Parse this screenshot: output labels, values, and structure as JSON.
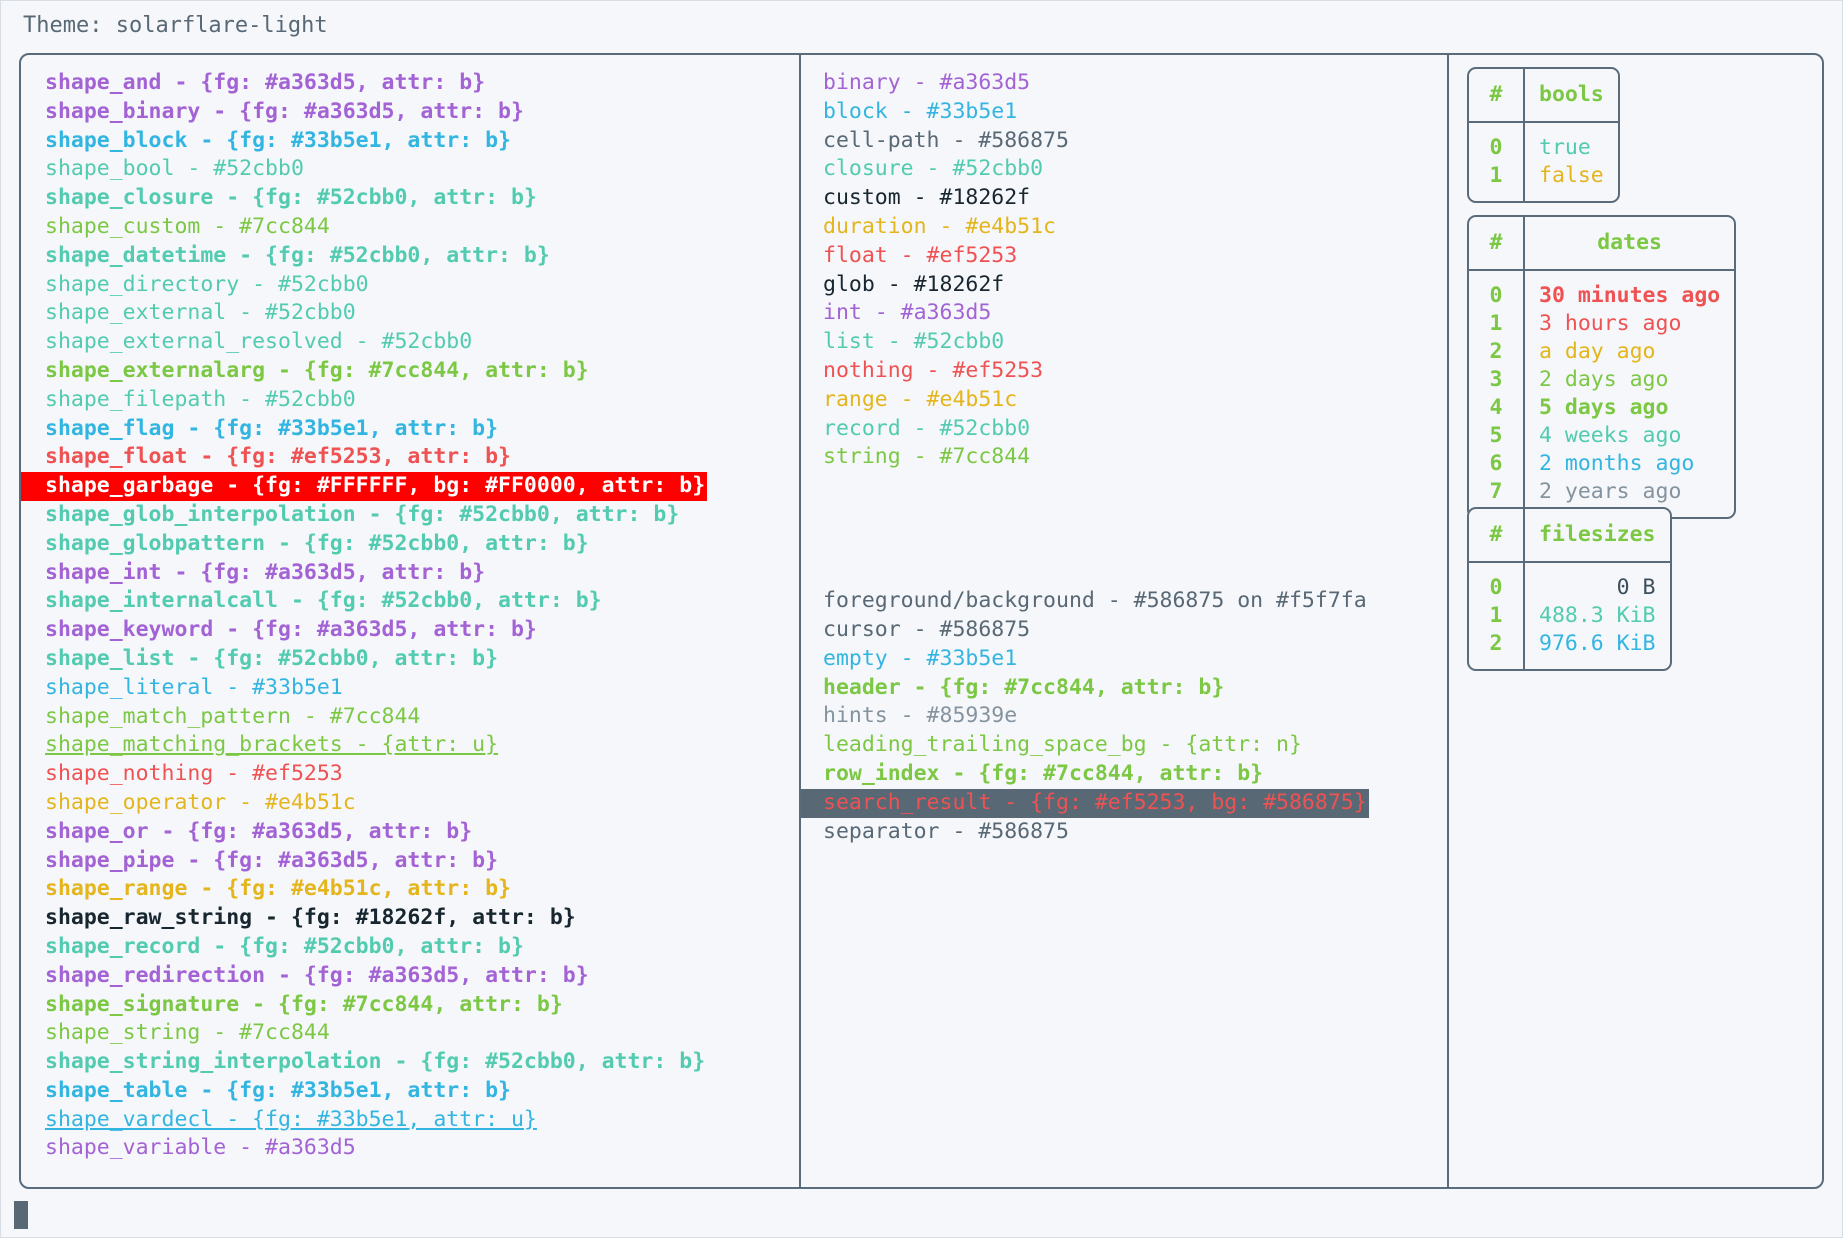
{
  "header": {
    "theme_label": "Theme: solarflare-light"
  },
  "palette": {
    "purple": "#a363d5",
    "blue": "#33b5e1",
    "teal": "#52cbb0",
    "green": "#7cc844",
    "red": "#ef5253",
    "amber": "#e4b51c",
    "dark": "#18262f",
    "gray": "#586875",
    "hint_gray": "#85939e",
    "background": "#f5f7fa",
    "garbage_fg": "#FFFFFF",
    "garbage_bg": "#FF0000",
    "search_bg": "#586875"
  },
  "shapes_column": [
    {
      "text": "shape_and - {fg: #a363d5, attr: b}",
      "color": "#a363d5",
      "bold": true
    },
    {
      "text": "shape_binary - {fg: #a363d5, attr: b}",
      "color": "#a363d5",
      "bold": true
    },
    {
      "text": "shape_block - {fg: #33b5e1, attr: b}",
      "color": "#33b5e1",
      "bold": true
    },
    {
      "text": "shape_bool - #52cbb0",
      "color": "#52cbb0",
      "bold": false
    },
    {
      "text": "shape_closure - {fg: #52cbb0, attr: b}",
      "color": "#52cbb0",
      "bold": true
    },
    {
      "text": "shape_custom - #7cc844",
      "color": "#7cc844",
      "bold": false
    },
    {
      "text": "shape_datetime - {fg: #52cbb0, attr: b}",
      "color": "#52cbb0",
      "bold": true
    },
    {
      "text": "shape_directory - #52cbb0",
      "color": "#52cbb0",
      "bold": false
    },
    {
      "text": "shape_external - #52cbb0",
      "color": "#52cbb0",
      "bold": false
    },
    {
      "text": "shape_external_resolved - #52cbb0",
      "color": "#52cbb0",
      "bold": false
    },
    {
      "text": "shape_externalarg - {fg: #7cc844, attr: b}",
      "color": "#7cc844",
      "bold": true
    },
    {
      "text": "shape_filepath - #52cbb0",
      "color": "#52cbb0",
      "bold": false
    },
    {
      "text": "shape_flag - {fg: #33b5e1, attr: b}",
      "color": "#33b5e1",
      "bold": true
    },
    {
      "text": "shape_float - {fg: #ef5253, attr: b}",
      "color": "#ef5253",
      "bold": true
    },
    {
      "text": "shape_garbage - {fg: #FFFFFF, bg: #FF0000, attr: b}",
      "color": "#FFFFFF",
      "bg": "#FF0000",
      "bold": true
    },
    {
      "text": "shape_glob_interpolation - {fg: #52cbb0, attr: b}",
      "color": "#52cbb0",
      "bold": true
    },
    {
      "text": "shape_globpattern - {fg: #52cbb0, attr: b}",
      "color": "#52cbb0",
      "bold": true
    },
    {
      "text": "shape_int - {fg: #a363d5, attr: b}",
      "color": "#a363d5",
      "bold": true
    },
    {
      "text": "shape_internalcall - {fg: #52cbb0, attr: b}",
      "color": "#52cbb0",
      "bold": true
    },
    {
      "text": "shape_keyword - {fg: #a363d5, attr: b}",
      "color": "#a363d5",
      "bold": true
    },
    {
      "text": "shape_list - {fg: #52cbb0, attr: b}",
      "color": "#52cbb0",
      "bold": true
    },
    {
      "text": "shape_literal - #33b5e1",
      "color": "#33b5e1",
      "bold": false
    },
    {
      "text": "shape_match_pattern - #7cc844",
      "color": "#7cc844",
      "bold": false
    },
    {
      "text": "shape_matching_brackets - {attr: u}",
      "color": "#7cc844",
      "bold": false,
      "underline": true
    },
    {
      "text": "shape_nothing - #ef5253",
      "color": "#ef5253",
      "bold": false
    },
    {
      "text": "shape_operator - #e4b51c",
      "color": "#e4b51c",
      "bold": false
    },
    {
      "text": "shape_or - {fg: #a363d5, attr: b}",
      "color": "#a363d5",
      "bold": true
    },
    {
      "text": "shape_pipe - {fg: #a363d5, attr: b}",
      "color": "#a363d5",
      "bold": true
    },
    {
      "text": "shape_range - {fg: #e4b51c, attr: b}",
      "color": "#e4b51c",
      "bold": true
    },
    {
      "text": "shape_raw_string - {fg: #18262f, attr: b}",
      "color": "#18262f",
      "bold": true
    },
    {
      "text": "shape_record - {fg: #52cbb0, attr: b}",
      "color": "#52cbb0",
      "bold": true
    },
    {
      "text": "shape_redirection - {fg: #a363d5, attr: b}",
      "color": "#a363d5",
      "bold": true
    },
    {
      "text": "shape_signature - {fg: #7cc844, attr: b}",
      "color": "#7cc844",
      "bold": true
    },
    {
      "text": "shape_string - #7cc844",
      "color": "#7cc844",
      "bold": false
    },
    {
      "text": "shape_string_interpolation - {fg: #52cbb0, attr: b}",
      "color": "#52cbb0",
      "bold": true
    },
    {
      "text": "shape_table - {fg: #33b5e1, attr: b}",
      "color": "#33b5e1",
      "bold": true
    },
    {
      "text": "shape_vardecl - {fg: #33b5e1, attr: u}",
      "color": "#33b5e1",
      "bold": false,
      "underline": true
    },
    {
      "text": "shape_variable - #a363d5",
      "color": "#a363d5",
      "bold": false
    }
  ],
  "types_column": [
    {
      "text": "binary - #a363d5",
      "color": "#a363d5",
      "bold": false
    },
    {
      "text": "block - #33b5e1",
      "color": "#33b5e1",
      "bold": false
    },
    {
      "text": "cell-path - #586875",
      "color": "#586875",
      "bold": false
    },
    {
      "text": "closure - #52cbb0",
      "color": "#52cbb0",
      "bold": false
    },
    {
      "text": "custom - #18262f",
      "color": "#18262f",
      "bold": false
    },
    {
      "text": "duration - #e4b51c",
      "color": "#e4b51c",
      "bold": false
    },
    {
      "text": "float - #ef5253",
      "color": "#ef5253",
      "bold": false
    },
    {
      "text": "glob - #18262f",
      "color": "#18262f",
      "bold": false
    },
    {
      "text": "int - #a363d5",
      "color": "#a363d5",
      "bold": false
    },
    {
      "text": "list - #52cbb0",
      "color": "#52cbb0",
      "bold": false
    },
    {
      "text": "nothing - #ef5253",
      "color": "#ef5253",
      "bold": false
    },
    {
      "text": "range - #e4b51c",
      "color": "#e4b51c",
      "bold": false
    },
    {
      "text": "record - #52cbb0",
      "color": "#52cbb0",
      "bold": false
    },
    {
      "text": "string - #7cc844",
      "color": "#7cc844",
      "bold": false
    }
  ],
  "ui_column": [
    {
      "text": "foreground/background - #586875 on #f5f7fa",
      "color": "#586875",
      "bold": false
    },
    {
      "text": "cursor - #586875",
      "color": "#586875",
      "bold": false
    },
    {
      "text": "empty - #33b5e1",
      "color": "#33b5e1",
      "bold": false
    },
    {
      "text": "header - {fg: #7cc844, attr: b}",
      "color": "#7cc844",
      "bold": true
    },
    {
      "text": "hints - #85939e",
      "color": "#85939e",
      "bold": false
    },
    {
      "text": "leading_trailing_space_bg - {attr: n}",
      "color": "#7cc844",
      "bold": false
    },
    {
      "text": "row_index - {fg: #7cc844, attr: b}",
      "color": "#7cc844",
      "bold": true
    },
    {
      "text": "search_result - {fg: #ef5253, bg: #586875}",
      "color": "#ef5253",
      "bg": "#586875",
      "bold": false
    },
    {
      "text": "separator - #586875",
      "color": "#586875",
      "bold": false
    }
  ],
  "tables": [
    {
      "name": "bools",
      "index_header": "#",
      "value_header": "bools",
      "align": "left",
      "rows": [
        {
          "index": "0",
          "value": "true",
          "color": "#52cbb0",
          "bold": false
        },
        {
          "index": "1",
          "value": "false",
          "color": "#e4b51c",
          "bold": false
        }
      ]
    },
    {
      "name": "dates",
      "index_header": "#",
      "value_header": "dates",
      "align": "left",
      "rows": [
        {
          "index": "0",
          "value": "30 minutes ago",
          "color": "#ef5253",
          "bold": true
        },
        {
          "index": "1",
          "value": "3 hours ago",
          "color": "#ef5253",
          "bold": false
        },
        {
          "index": "2",
          "value": "a day ago",
          "color": "#e4b51c",
          "bold": false
        },
        {
          "index": "3",
          "value": "2 days ago",
          "color": "#7cc844",
          "bold": false
        },
        {
          "index": "4",
          "value": "5 days ago",
          "color": "#7cc844",
          "bold": true
        },
        {
          "index": "5",
          "value": "4 weeks ago",
          "color": "#52cbb0",
          "bold": false
        },
        {
          "index": "6",
          "value": "2 months ago",
          "color": "#33b5e1",
          "bold": false
        },
        {
          "index": "7",
          "value": "2 years ago",
          "color": "#85939e",
          "bold": false
        }
      ]
    },
    {
      "name": "filesizes",
      "index_header": "#",
      "value_header": "filesizes",
      "align": "right",
      "rows": [
        {
          "index": "0",
          "value": "0 B",
          "color": "#3d4f5c",
          "bold": false
        },
        {
          "index": "1",
          "value": "488.3 KiB",
          "color": "#52cbb0",
          "bold": false
        },
        {
          "index": "2",
          "value": "976.6 KiB",
          "color": "#33b5e1",
          "bold": false
        }
      ]
    }
  ],
  "cursor": {
    "label": "terminal-cursor"
  }
}
